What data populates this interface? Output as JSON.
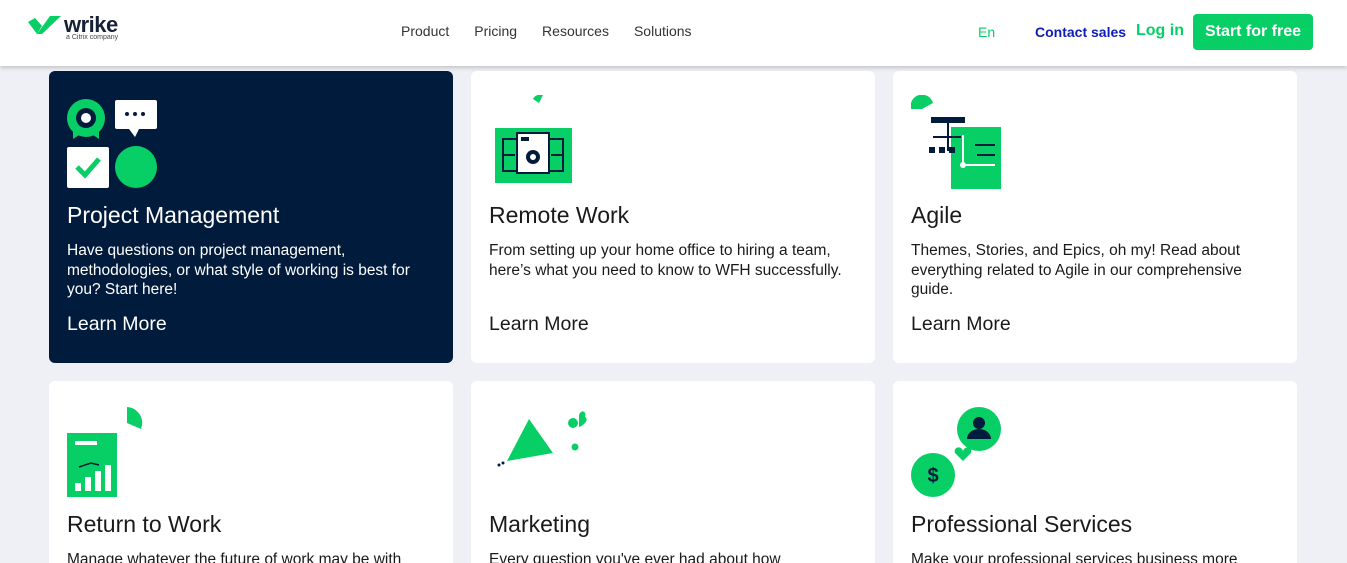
{
  "brand": {
    "name": "wrike",
    "tagline": "a Citrix company",
    "accent": "#08cf65",
    "navy": "#001b3c",
    "link_blue": "#0d1db8"
  },
  "header": {
    "nav": [
      "Product",
      "Pricing",
      "Resources",
      "Solutions"
    ],
    "language": "En",
    "contact_sales": "Contact sales",
    "login": "Log in",
    "cta": "Start for free"
  },
  "cards": [
    {
      "title": "Project Management",
      "description": "Have questions on project management, methodologies, or what style of working is best for you? Start here!",
      "link": "Learn More",
      "icon": "project-management-icon",
      "highlighted": true
    },
    {
      "title": "Remote Work",
      "description": "From setting up your home office to hiring a team, here’s what you need to know to WFH successfully.",
      "link": "Learn More",
      "icon": "remote-work-icon"
    },
    {
      "title": "Agile",
      "description": "Themes, Stories, and Epics, oh my! Read about everything related to Agile in our comprehensive guide.",
      "link": "Learn More",
      "icon": "agile-icon"
    },
    {
      "title": "Return to Work",
      "description": "Manage whatever the future of work may be with",
      "icon": "return-to-work-icon"
    },
    {
      "title": "Marketing",
      "description": "Every question you've ever had about how",
      "icon": "marketing-icon"
    },
    {
      "title": "Professional Services",
      "description": "Make your professional services business more",
      "icon": "professional-services-icon"
    }
  ]
}
